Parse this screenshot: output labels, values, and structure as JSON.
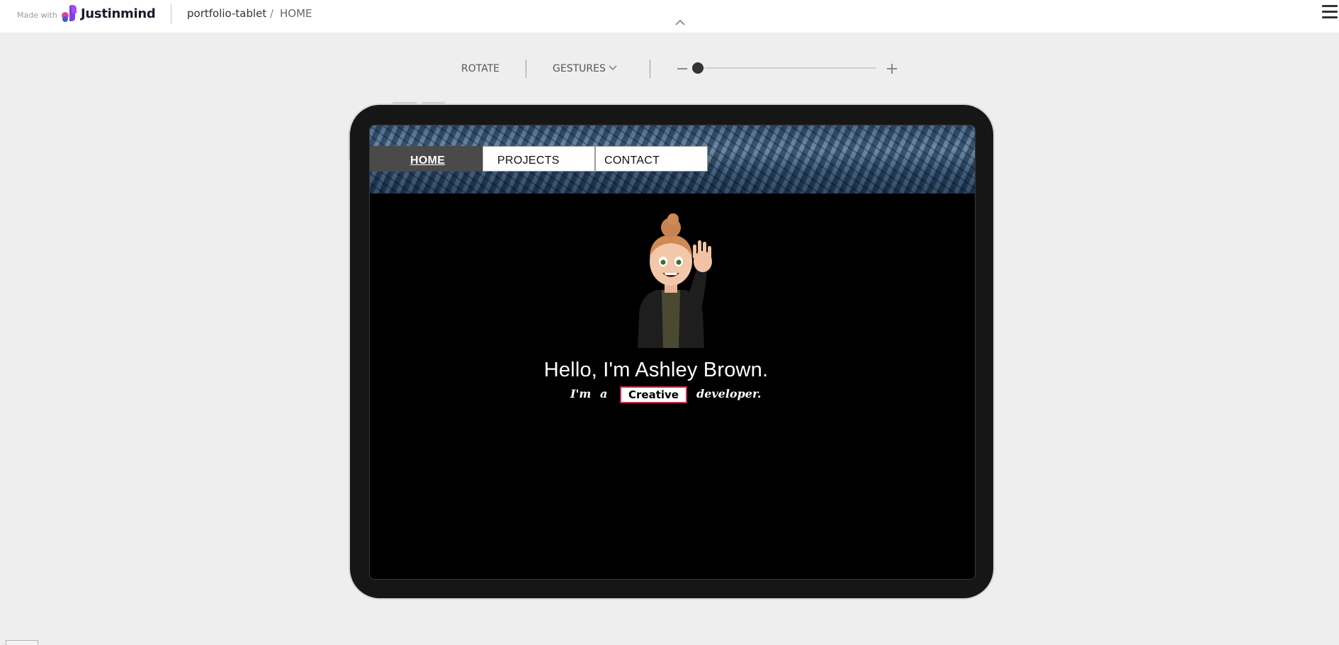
{
  "header": {
    "made_with": "Made with",
    "brand": "Justinmind",
    "project": "portfolio-tablet",
    "separator": "/",
    "page": "HOME"
  },
  "toolbar": {
    "rotate_label": "ROTATE",
    "gestures_label": "GESTURES",
    "zoom_level": 0.0
  },
  "prototype": {
    "nav": [
      {
        "label": "HOME",
        "active": true
      },
      {
        "label": "PROJECTS",
        "active": false
      },
      {
        "label": "CONTACT",
        "active": false
      }
    ],
    "greeting": "Hello, I'm Ashley Brown.",
    "tagline": {
      "prefix_im": "I'm",
      "prefix_a": "a",
      "highlight": "Creative",
      "suffix": "developer."
    }
  },
  "colors": {
    "background": "#eeeeee",
    "device_frame": "#161616",
    "screen": "#000000",
    "highlight_border": "#c62d4b",
    "nav_active": "#4a4a4a"
  },
  "icons": [
    "justinmind-logo-icon",
    "hamburger-menu-icon",
    "chevron-up-icon",
    "chevron-down-icon",
    "zoom-minus-icon",
    "zoom-plus-icon",
    "avatar-waving-image"
  ]
}
